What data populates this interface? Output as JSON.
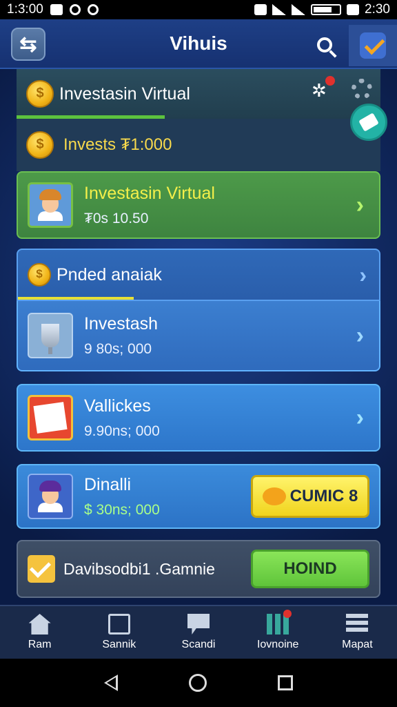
{
  "status": {
    "time_left": "1:3:00",
    "time_right": "2:30"
  },
  "header": {
    "title": "Vihuis"
  },
  "top_panel": {
    "title": "Investasin Virtual"
  },
  "invest_row": {
    "label": "Invests ₮1:000"
  },
  "cards": [
    {
      "name": "Investasin Virtual",
      "sub": "₮0s 10.50"
    },
    {
      "name": "Investash",
      "sub": "9 80s; 000"
    },
    {
      "name": "Vallickes",
      "sub": "9.90ns; 000"
    },
    {
      "name": "Dinalli",
      "sub": "$ 30ns; 000",
      "cta": "CUMIC 8"
    }
  ],
  "pended": {
    "label": "Pnded anaiak"
  },
  "bottom_card": {
    "label": "Davibsodbi1 .Gamnie",
    "cta": "HOIND"
  },
  "nav": [
    {
      "label": "Ram"
    },
    {
      "label": "Sannik"
    },
    {
      "label": "Scandi"
    },
    {
      "label": "Iovnoine"
    },
    {
      "label": "Mapat"
    }
  ],
  "colors": {
    "header": "#1e3f86",
    "accent_green": "#5fc43a",
    "accent_yellow": "#f0d41d",
    "card_blue": "#2f6bbd"
  },
  "icons": [
    "back-icon",
    "search-icon",
    "profile-icon",
    "coin-icon",
    "bug-icon",
    "gear-icon",
    "ticket-icon",
    "chevron-right-icon",
    "checkbox-icon",
    "home-icon",
    "edit-icon",
    "flag-icon",
    "chart-icon",
    "map-icon"
  ]
}
